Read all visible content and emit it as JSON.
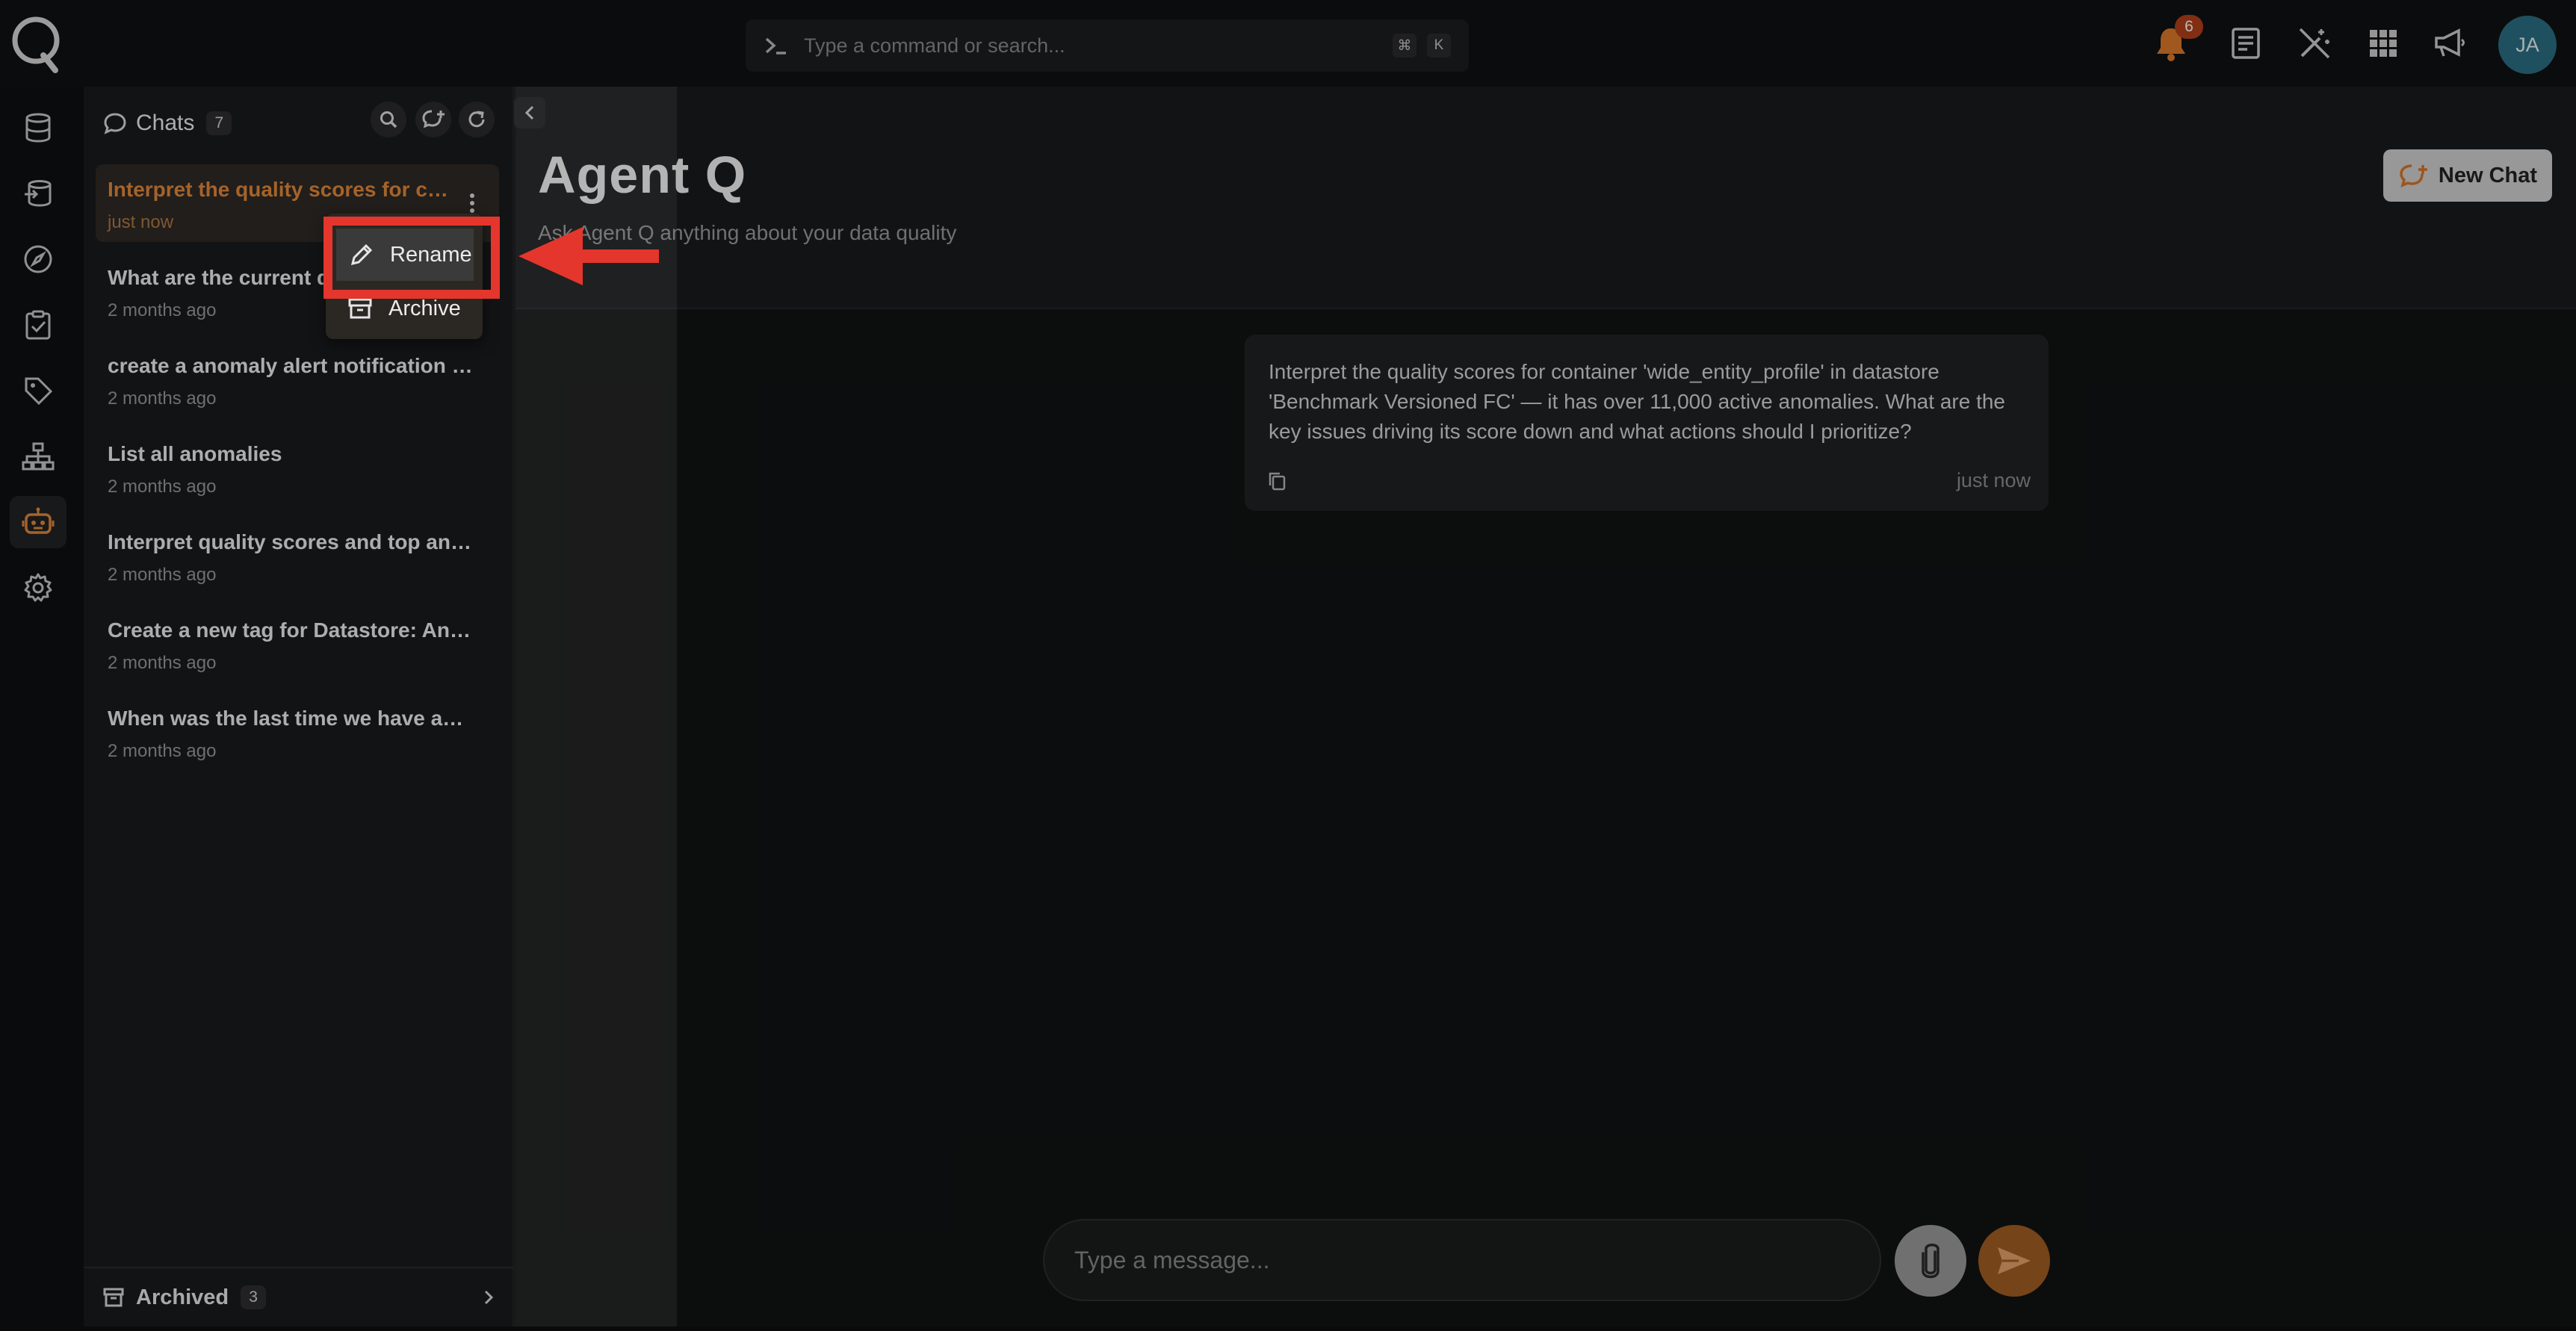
{
  "topbar": {
    "search_placeholder": "Type a command or search...",
    "shortcut_keys": [
      "⌘",
      "K"
    ],
    "notifications_count": "6",
    "avatar_initials": "JA"
  },
  "sidebar_nav": {
    "items": [
      "datastores",
      "sources",
      "explore",
      "checks",
      "tags",
      "lineage",
      "agent-q",
      "settings"
    ],
    "active": "agent-q"
  },
  "chats_panel": {
    "title": "Chats",
    "count": "7",
    "items": [
      {
        "title": "Interpret the quality scores for container 'wide_entity_profile'",
        "time": "just now",
        "active": true
      },
      {
        "title": "What are the current quality issues",
        "time": "2 months ago"
      },
      {
        "title": "create a anomaly alert notification for datastore",
        "time": "2 months ago"
      },
      {
        "title": "List all anomalies",
        "time": "2 months ago"
      },
      {
        "title": "Interpret quality scores and top anomalies",
        "time": "2 months ago"
      },
      {
        "title": "Create a new tag for Datastore: Analytics",
        "time": "2 months ago"
      },
      {
        "title": "When was the last time we have an anomaly",
        "time": "2 months ago"
      }
    ],
    "archived_label": "Archived",
    "archived_count": "3"
  },
  "context_menu": {
    "rename": "Rename",
    "archive": "Archive"
  },
  "main": {
    "title": "Agent Q",
    "subtitle": "Ask Agent Q anything about your data quality",
    "new_chat_label": "New Chat",
    "message": {
      "text": "Interpret the quality scores for container 'wide_entity_profile' in datastore 'Benchmark Versioned FC' — it has over 11,000 active anomalies. What are the key issues driving its score down and what actions should I prioritize?",
      "time": "just now"
    },
    "composer_placeholder": "Type a message..."
  },
  "colors": {
    "accent": "#e58a3c",
    "highlight": "#e4362c",
    "avatar": "#2c6f84",
    "badge": "#b5401b"
  }
}
